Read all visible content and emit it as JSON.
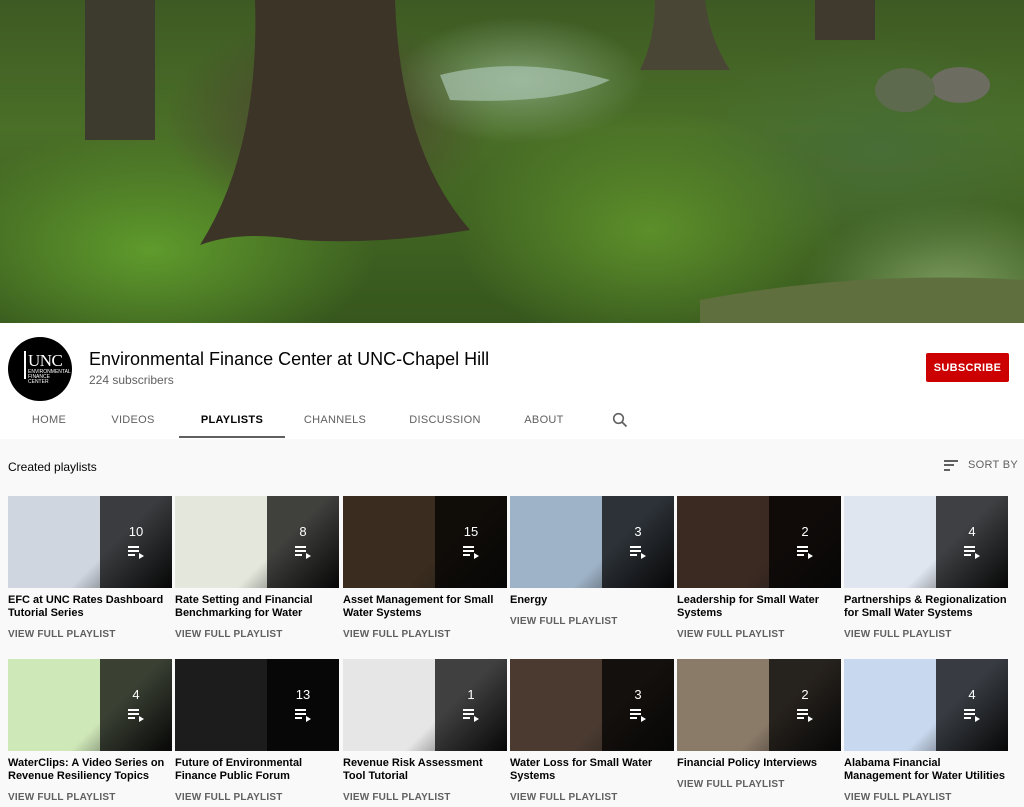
{
  "channel": {
    "name": "Environmental Finance Center at UNC-Chapel Hill",
    "subscribers": "224 subscribers",
    "subscribe_label": "SUBSCRIBE",
    "avatar_text": "UNC",
    "avatar_subtext": "ENVIRONMENTAL FINANCE CENTER"
  },
  "tabs": [
    {
      "label": "HOME"
    },
    {
      "label": "VIDEOS"
    },
    {
      "label": "PLAYLISTS",
      "active": true
    },
    {
      "label": "CHANNELS"
    },
    {
      "label": "DISCUSSION"
    },
    {
      "label": "ABOUT"
    }
  ],
  "section": {
    "title": "Created playlists",
    "sort_label": "SORT BY"
  },
  "view_label": "VIEW FULL PLAYLIST",
  "playlists": [
    {
      "title": "EFC at UNC Rates Dashboard Tutorial Series",
      "count": "10",
      "thumb_color": "#cfd6e0"
    },
    {
      "title": "Rate Setting and Financial Benchmarking for Water Systems",
      "count": "8",
      "thumb_color": "#e4e8dc"
    },
    {
      "title": "Asset Management for Small Water Systems",
      "count": "15",
      "thumb_color": "#3a2c1e"
    },
    {
      "title": "Energy",
      "count": "3",
      "thumb_color": "#9fb3c8"
    },
    {
      "title": "Leadership for Small Water Systems",
      "count": "2",
      "thumb_color": "#3b2a22"
    },
    {
      "title": "Partnerships & Regionalization for Small Water Systems",
      "count": "4",
      "thumb_color": "#dfe6f0"
    },
    {
      "title": "WaterClips: A Video Series on Revenue Resiliency Topics",
      "count": "4",
      "thumb_color": "#cfe8b8"
    },
    {
      "title": "Future of Environmental Finance Public Forum",
      "count": "13",
      "thumb_color": "#1c1c1c"
    },
    {
      "title": "Revenue Risk Assessment Tool Tutorial",
      "count": "1",
      "thumb_color": "#e6e6e6"
    },
    {
      "title": "Water Loss for Small Water Systems",
      "count": "3",
      "thumb_color": "#4a3a30"
    },
    {
      "title": "Financial Policy Interviews",
      "count": "2",
      "thumb_color": "#8a7a68"
    },
    {
      "title": "Alabama Financial Management for Water Utilities Webinar Series",
      "count": "4",
      "thumb_color": "#c8d8ee"
    }
  ]
}
